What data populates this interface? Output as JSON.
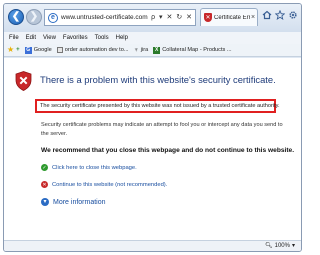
{
  "browser": {
    "address_url": "www.untrusted-certificate.com",
    "address_tools": "ρ ▾ ✕ ↻ ✕",
    "tab_label": "Certificate Error: Navi...",
    "tab_close": "×"
  },
  "menu": {
    "items": [
      "File",
      "Edit",
      "View",
      "Favorites",
      "Tools",
      "Help"
    ]
  },
  "favorites": {
    "items": [
      "Google",
      "order automation dev to...",
      "jira",
      "Collateral Map - Products ..."
    ]
  },
  "content": {
    "heading": "There is a problem with this website's security certificate.",
    "error_line": "The security certificate presented by this website was not issued by a trusted certificate authority.",
    "paragraph": "Security certificate problems may indicate an attempt to fool you or intercept any data you send to the server.",
    "recommend": "We recommend that you close this webpage and do not continue to this website.",
    "close_link": "Click here to close this webpage.",
    "continue_link": "Continue to this website (not recommended).",
    "more_info": "More information"
  },
  "status": {
    "zoom": "100%"
  },
  "colors": {
    "accent": "#1f3c7a",
    "error_border": "#e02020",
    "link": "#1a4fa0"
  }
}
